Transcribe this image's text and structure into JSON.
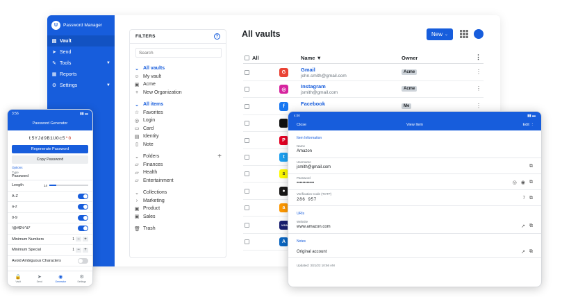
{
  "desktop": {
    "sidebar": {
      "brand": "Password Manager",
      "items": [
        {
          "label": "Vault",
          "icon": "vault-icon"
        },
        {
          "label": "Send",
          "icon": "send-icon"
        },
        {
          "label": "Tools",
          "icon": "tools-icon"
        },
        {
          "label": "Reports",
          "icon": "reports-icon"
        },
        {
          "label": "Settings",
          "icon": "settings-icon"
        }
      ]
    },
    "filters": {
      "title": "FILTERS",
      "search_placeholder": "Search",
      "all_vaults": "All vaults",
      "my_vault": "My vault",
      "acme": "Acme",
      "new_org": "New Organization",
      "all_items": "All items",
      "favorites": "Favorites",
      "login": "Login",
      "card": "Card",
      "identity": "Identity",
      "note": "Note",
      "folders": "Folders",
      "finances": "Finances",
      "health": "Health",
      "entertainment": "Entertainment",
      "collections": "Collections",
      "marketing": "Marketing",
      "product": "Product",
      "sales": "Sales",
      "trash": "Trash"
    },
    "main": {
      "title": "All vaults",
      "new_label": "New",
      "col_all": "All",
      "col_name": "Name",
      "col_owner": "Owner",
      "rows": [
        {
          "name": "Gmail",
          "user": "john.smith@gmail.com",
          "owner": "Acme",
          "icon": "G",
          "color": "#ea4335"
        },
        {
          "name": "Instagram",
          "user": "jsmith@gmail.com",
          "owner": "Acme",
          "icon": "◎",
          "color": "#d6249f"
        },
        {
          "name": "Facebook",
          "user": "",
          "owner": "Me",
          "icon": "f",
          "color": "#1877f2"
        },
        {
          "name": "",
          "user": "",
          "owner": "",
          "icon": "",
          "color": "#111111"
        },
        {
          "name": "",
          "user": "",
          "owner": "",
          "icon": "P",
          "color": "#e60023"
        },
        {
          "name": "",
          "user": "",
          "owner": "",
          "icon": "t",
          "color": "#1da1f2"
        },
        {
          "name": "",
          "user": "",
          "owner": "",
          "icon": "s",
          "color": "#fffc00"
        },
        {
          "name": "",
          "user": "",
          "owner": "",
          "icon": "●",
          "color": "#181717"
        },
        {
          "name": "",
          "user": "",
          "owner": "",
          "icon": "a",
          "color": "#ff9900"
        },
        {
          "name": "",
          "user": "",
          "owner": "",
          "icon": "VISA",
          "color": "#1a1f71"
        },
        {
          "name": "",
          "user": "",
          "owner": "",
          "icon": "A",
          "color": "#0a66c2"
        }
      ]
    }
  },
  "phone": {
    "status_time": "3:56",
    "title": "Password Generator",
    "password_plain": "t5YJd9B1UOc5",
    "password_red": "*0",
    "regenerate": "Regenerate Password",
    "copy": "Copy Password",
    "options_label": "Options",
    "type_label": "Type",
    "type_value": "Password",
    "length_label": "Length",
    "length_value": "14",
    "length_fill": 0.18,
    "opt_upper": "A-Z",
    "opt_lower": "a-z",
    "opt_digits": "0-9",
    "opt_special": "!@#$%^&*",
    "min_numbers": "Minimum Numbers",
    "min_numbers_value": "1",
    "min_special": "Minimum Special",
    "min_special_value": "1",
    "avoid_ambiguous": "Avoid Ambiguous Characters",
    "nav": [
      "Vault",
      "Send",
      "Generator",
      "Settings"
    ]
  },
  "tablet": {
    "status_time": "4:00",
    "close": "Close",
    "title": "View Item",
    "edit": "Edit",
    "item_info": "Item Information",
    "name_label": "Name",
    "name_value": "Amazon",
    "username_label": "Username",
    "username_value": "jsmith@gmail.com",
    "password_label": "Password",
    "password_value": "••••••••••••",
    "totp_label": "Verification Code (TOTP)",
    "totp_value": "286  957",
    "totp_seconds": "7",
    "uris": "URIs",
    "website_label": "Website",
    "website_value": "www.amazon.com",
    "notes": "Notes",
    "notes_value": "Original account",
    "updated": "Updated: 3/21/22 10:56 AM"
  }
}
